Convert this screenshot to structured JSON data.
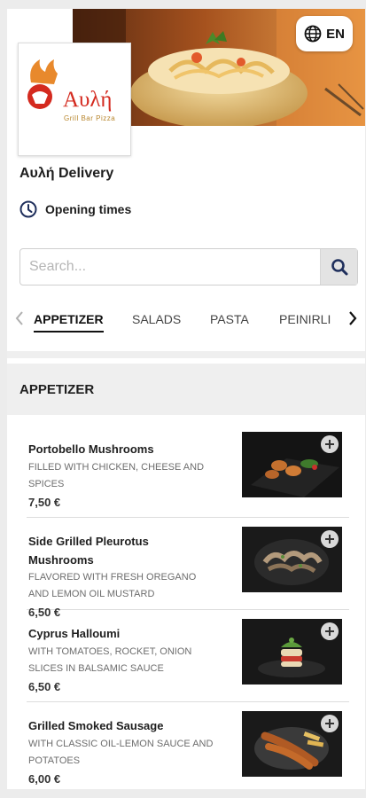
{
  "header": {
    "language_label": "EN",
    "store_name": "Αυλή Delivery",
    "opening_times_label": "Opening times",
    "logo": {
      "brand_text": "Αυλή",
      "tagline": "Grill Bar Pizza"
    }
  },
  "search": {
    "placeholder": "Search..."
  },
  "tabs": {
    "items": [
      {
        "label": "APPETIZER"
      },
      {
        "label": "SALADS"
      },
      {
        "label": "PASTA"
      },
      {
        "label": "PEINIRLI"
      }
    ]
  },
  "section": {
    "title": "APPETIZER",
    "items": [
      {
        "name": "Portobello Mushrooms",
        "description": "FILLED WITH CHICKEN, CHEESE AND SPICES",
        "price": "7,50 €"
      },
      {
        "name": "Side Grilled Pleurotus Mushrooms",
        "description": "FLAVORED WITH FRESH OREGANO AND LEMON OIL MUSTARD",
        "price": "6,50 €"
      },
      {
        "name": "Cyprus Halloumi",
        "description": "WITH TOMATOES, ROCKET, ONION SLICES IN BALSAMIC SAUCE",
        "price": "6,50 €"
      },
      {
        "name": "Grilled Smoked Sausage",
        "description": "WITH CLASSIC OIL-LEMON SAUCE AND POTATOES",
        "price": "6,00 €"
      }
    ]
  },
  "colors": {
    "accent_navy": "#1f2f5c",
    "brand_red": "#d42a1f",
    "brand_gold": "#b8862e"
  },
  "icons": [
    "globe-icon",
    "clock-icon",
    "search-icon",
    "chevron-left-icon",
    "chevron-right-icon",
    "plus-icon"
  ]
}
